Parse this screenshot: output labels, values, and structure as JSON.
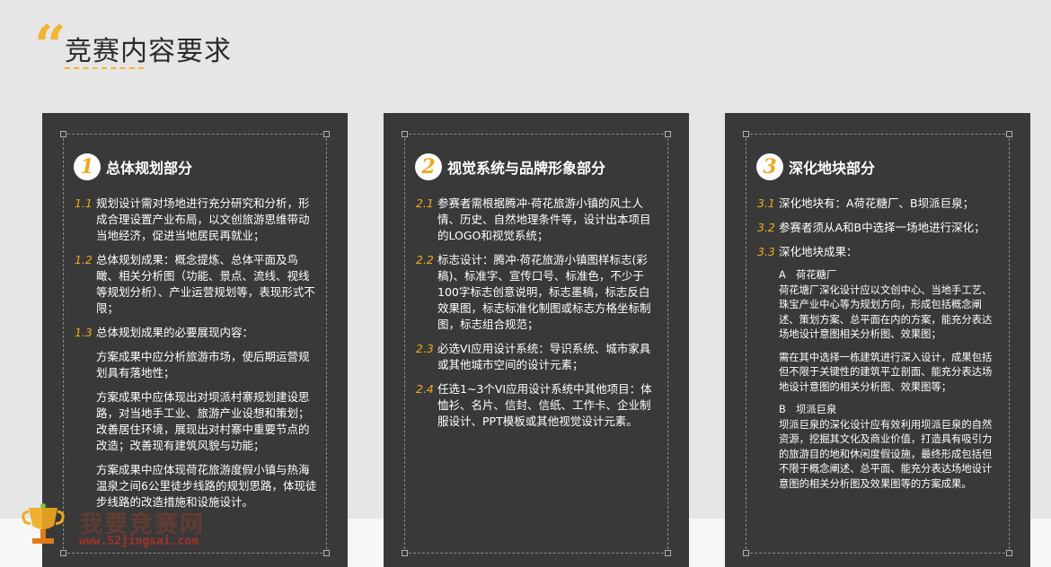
{
  "header": {
    "title": "竞赛内容要求"
  },
  "cards": [
    {
      "number": "1",
      "title": "总体规划部分",
      "items": [
        {
          "num": "1.1",
          "text": "规划设计需对场地进行充分研究和分析，形成合理设置产业布局，以文创旅游思维带动当地经济，促进当地居民再就业；"
        },
        {
          "num": "1.2",
          "text": "总体规划成果：概念提炼、总体平面及鸟瞰、相关分析图（功能、景点、流线、视线等规划分析）、产业运营规划等，表现形式不限；"
        },
        {
          "num": "1.3",
          "text": "总体规划成果的必要展现内容："
        }
      ],
      "subs": [
        "方案成果中应分析旅游市场，使后期运营规划具有落地性；",
        "方案成果中应体现出对坝派村寨规划建设思路，对当地手工业、旅游产业设想和策划；改善居住环境，展现出对村寨中重要节点的改造；改善现有建筑风貌与功能；",
        "方案成果中应体现荷花旅游度假小镇与热海温泉之间6公里徒步线路的规划思路，体现徒步线路的改造措施和设施设计。"
      ]
    },
    {
      "number": "2",
      "title": "视觉系统与品牌形象部分",
      "items": [
        {
          "num": "2.1",
          "text": "参赛者需根据腾冲·荷花旅游小镇的风土人情、历史、自然地理条件等，设计出本项目的LOGO和视觉系统；"
        },
        {
          "num": "2.2",
          "text": "标志设计：腾冲·荷花旅游小镇图样标志(彩稿)、标准字、宣传口号、标准色，不少于100字标志创意说明，标志墨稿，标志反白效果图，标志标准化制图或标志方格坐标制图，标志组合规范；"
        },
        {
          "num": "2.3",
          "text": "必选VI应用设计系统：导识系统、城市家具或其他城市空间的设计元素；"
        },
        {
          "num": "2.4",
          "text": "任选1~3个VI应用设计系统中其他项目：体恤衫、名片、信封、信纸、工作卡、企业制服设计、PPT模板或其他视觉设计元素。"
        }
      ]
    },
    {
      "number": "3",
      "title": "深化地块部分",
      "items": [
        {
          "num": "3.1",
          "text": "深化地块有：A荷花糖厂、B坝派巨泉；"
        },
        {
          "num": "3.2",
          "text": "参赛者须从A和B中选择一场地进行深化；"
        },
        {
          "num": "3.3",
          "text": "深化地块成果："
        }
      ],
      "subs": [
        {
          "head": "A　荷花糖厂",
          "text": "荷花塘厂深化设计应以文创中心、当地手工艺、珠宝产业中心等为规划方向，形成包括概念阐述、策划方案、总平面在内的方案，能充分表达场地设计意图相关分析图、效果图；"
        },
        {
          "head": "",
          "text": "需在其中选择一栋建筑进行深入设计，成果包括但不限于关键性的建筑平立剖面、能充分表达场地设计意图的相关分析图、效果图等；"
        },
        {
          "head": "B　坝派巨泉",
          "text": "坝派巨泉的深化设计应有效利用坝派巨泉的自然资源，挖掘其文化及商业价值，打造具有吸引力的旅游目的地和休闲度假设施，最终形成包括但不限于概念阐述、总平面、能充分表达场地设计意图的相关分析图及效果图等的方案成果。"
        }
      ]
    }
  ],
  "watermark": {
    "name": "我要竞赛网",
    "url": "www.52jingsai.com"
  },
  "colors": {
    "accent": "#f0a81c",
    "card_bg": "#393939",
    "page_bg": "#e6e6e6"
  }
}
